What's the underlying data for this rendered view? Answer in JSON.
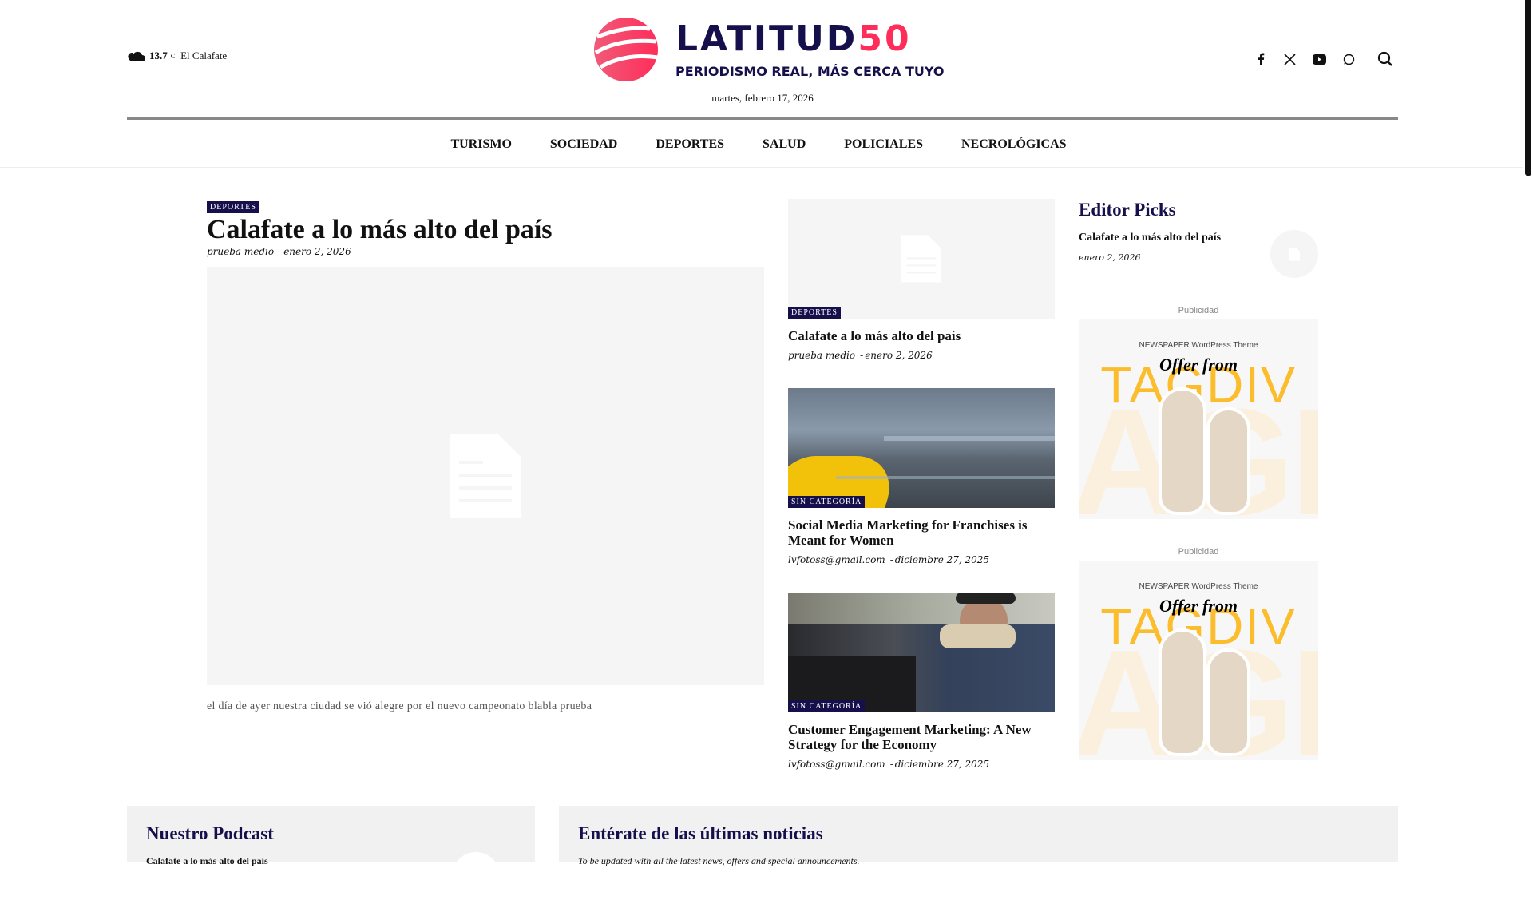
{
  "header": {
    "weather": {
      "temp": "13.7",
      "unit": "C",
      "city": "El Calafate",
      "icon": "cloud-icon"
    },
    "logo": {
      "name": "LATITUD",
      "number": "50",
      "tagline": "PERIODISMO REAL, MÁS CERCA TUYO"
    },
    "date": "martes, febrero 17, 2026",
    "social": [
      "facebook-icon",
      "x-icon",
      "youtube-icon",
      "whatsapp-icon",
      "search-icon"
    ]
  },
  "nav": {
    "items": [
      "TURISMO",
      "SOCIEDAD",
      "DEPORTES",
      "SALUD",
      "POLICIALES",
      "NECROLÓGICAS"
    ]
  },
  "main": {
    "category": "DEPORTES",
    "title": "Calafate a lo más alto del país",
    "author": "prueba medio",
    "date": "enero 2, 2026",
    "excerpt": "el día de ayer nuestra ciudad se vió alegre por el nuevo campeonato blabla prueba"
  },
  "middle": [
    {
      "category": "DEPORTES",
      "title": "Calafate a lo más alto del país",
      "author": "prueba medio",
      "date": "enero 2, 2026"
    },
    {
      "category": "SIN CATEGORÍA",
      "title": "Social Media Marketing for Franchises is Meant for Women",
      "author": "lvfotoss@gmail.com",
      "date": "diciembre 27, 2025"
    },
    {
      "category": "SIN CATEGORÍA",
      "title": "Customer Engagement Marketing: A New Strategy for the Economy",
      "author": "lvfotoss@gmail.com",
      "date": "diciembre 27, 2025"
    }
  ],
  "sidebar": {
    "heading": "Editor Picks",
    "pick": {
      "title": "Calafate a lo más alto del país",
      "date": "enero 2, 2026"
    },
    "ad_label": "Publicidad",
    "ad": {
      "line1": "NEWSPAPER WordPress Theme",
      "line2": "Offer from",
      "brand": "TAGDIV",
      "bg": "AGD"
    }
  },
  "bottom": {
    "podcast": {
      "heading": "Nuestro Podcast",
      "item": "Calafate a lo más alto del país"
    },
    "newsletter": {
      "heading": "Entérate de las últimas noticias",
      "text": "To be updated with all the latest news, offers and special announcements."
    }
  },
  "colors": {
    "brand_navy": "#15104b",
    "brand_pink": "#ff2d5a"
  }
}
